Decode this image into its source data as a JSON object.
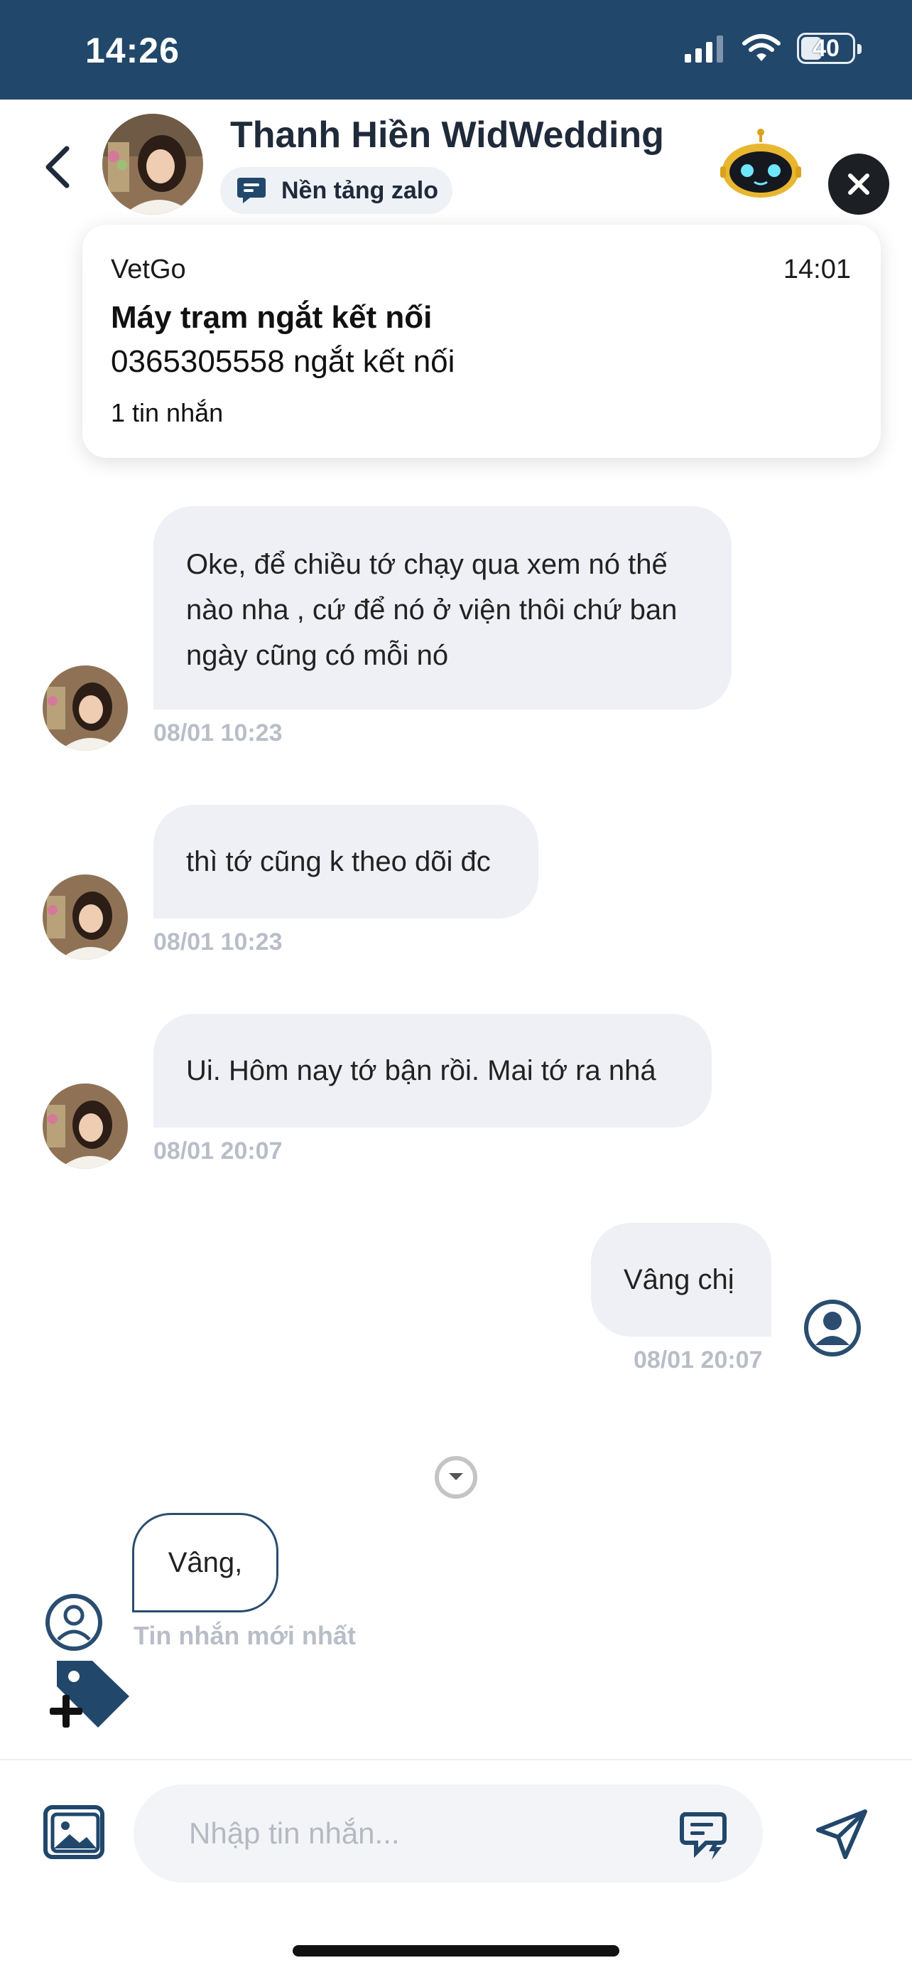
{
  "status_bar": {
    "time": "14:26",
    "battery_level": "40",
    "colors": {
      "background": "#21476b"
    }
  },
  "header": {
    "contact_name": "Thanh Hiền WidWedding",
    "platform_label": "Nền tảng zalo",
    "icons": [
      "back-icon",
      "chat-bubble-icon",
      "bot-icon",
      "close-icon"
    ]
  },
  "notification": {
    "app": "VetGo",
    "time": "14:01",
    "title": "Máy trạm ngắt kết nối",
    "body": "0365305558 ngắt kết nối",
    "count": "1 tin nhắn"
  },
  "messages": [
    {
      "direction": "in",
      "text": "Oke, để chiều tớ chạy qua xem nó thế nào nha , cứ để nó ở viện thôi chứ ban ngày cũng có mỗi nó",
      "time": "08/01 10:23"
    },
    {
      "direction": "in",
      "text": "thì tớ cũng k theo dõi đc",
      "time": "08/01 10:23"
    },
    {
      "direction": "in",
      "text": "Ui. Hôm nay tớ bận rồi. Mai tớ ra nhá",
      "time": "08/01 20:07"
    },
    {
      "direction": "out",
      "text": "Vâng chị",
      "time": "08/01 20:07"
    }
  ],
  "latest": {
    "text": "Vâng,",
    "label": "Tin nhắn mới nhất"
  },
  "composer": {
    "placeholder": "Nhập tin nhắn...",
    "icons": [
      "gallery-icon",
      "quick-reply-icon",
      "send-icon",
      "tag-add-icon"
    ]
  },
  "colors": {
    "accent": "#21476b",
    "bubble": "#eef0f5",
    "timestamp": "#b8bec8"
  }
}
